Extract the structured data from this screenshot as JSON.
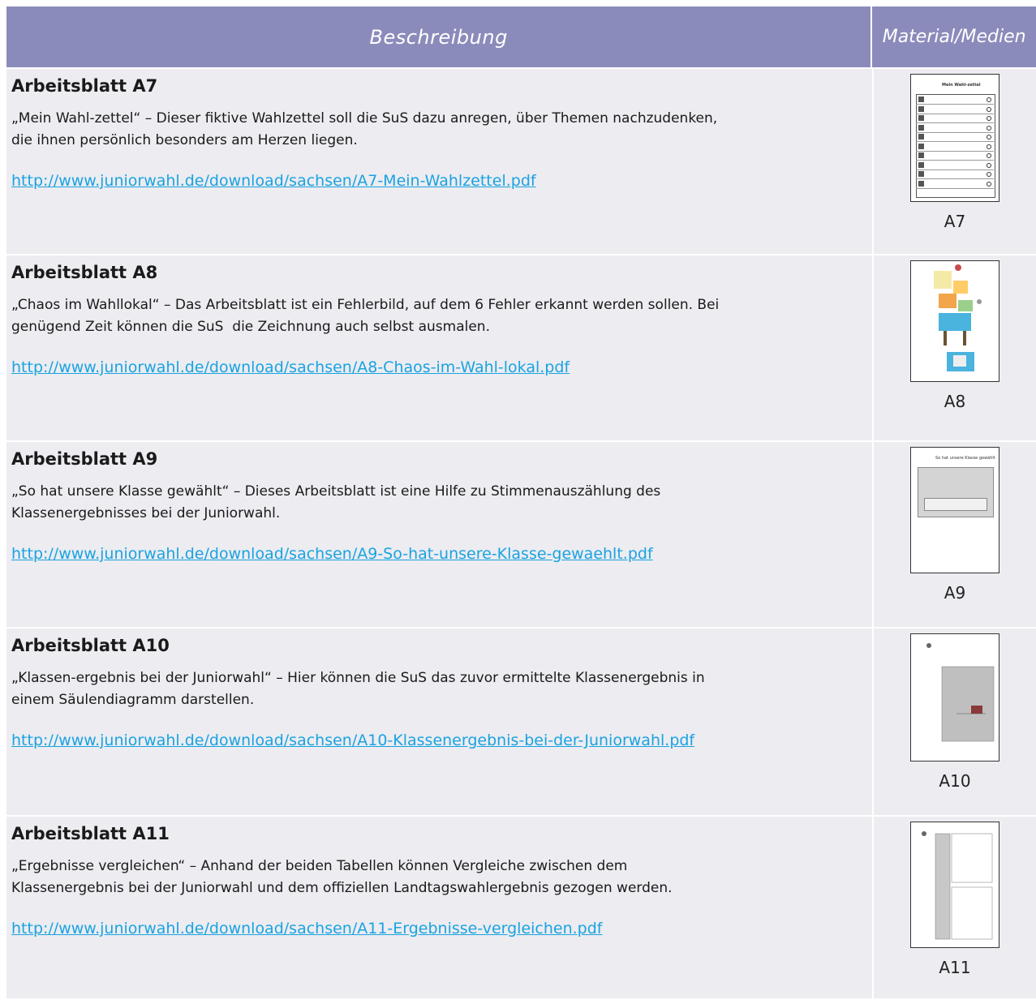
{
  "header": {
    "col1": "Beschreibung",
    "col2_line1": "Material/",
    "col2_line2": "Medien"
  },
  "rows": [
    {
      "title": "Arbeitsblatt A7",
      "desc": "„Mein Wahl-zettel“ – Dieser fiktive Wahlzettel soll die SuS dazu anregen, über Themen nachzudenken,\ndie ihnen persönlich besonders am Herzen liegen.",
      "link": "http://www.juniorwahl.de/download/sachsen/A7-Mein-Wahlzettel.pdf",
      "caption": "A7",
      "thumb_title": "Mein Wahl-zettel"
    },
    {
      "title": "Arbeitsblatt A8",
      "desc": "„Chaos im Wahllokal“ – Das Arbeitsblatt ist ein Fehlerbild, auf dem 6 Fehler erkannt werden sollen. Bei\ngenügend Zeit können die SuS  die Zeichnung auch selbst ausmalen.",
      "link": "http://www.juniorwahl.de/download/sachsen/A8-Chaos-im-Wahl-lokal.pdf",
      "caption": "A8"
    },
    {
      "title": "Arbeitsblatt A9",
      "desc": "„So hat unsere Klasse gewählt“ – Dieses Arbeitsblatt ist eine Hilfe zu Stimmenauszählung des\nKlassenergebnisses bei der Juniorwahl.",
      "link": "http://www.juniorwahl.de/download/sachsen/A9-So-hat-unsere-Klasse-gewaehlt.pdf",
      "caption": "A9",
      "thumb_title": "So hat unsere Klasse gewählt"
    },
    {
      "title": "Arbeitsblatt A10",
      "desc": "„Klassen-ergebnis bei der Juniorwahl“ – Hier können die SuS das zuvor ermittelte Klassenergebnis in\neinem Säulendiagramm darstellen.",
      "link": "http://www.juniorwahl.de/download/sachsen/A10-Klassenergebnis-bei-der-Juniorwahl.pdf",
      "caption": "A10"
    },
    {
      "title": "Arbeitsblatt A11",
      "desc": "„Ergebnisse vergleichen“ – Anhand der beiden Tabellen können Vergleiche zwischen dem\nKlassenergebnis bei der Juniorwahl und dem offiziellen Landtagswahlergebnis gezogen werden.",
      "link": "http://www.juniorwahl.de/download/sachsen/A11-Ergebnisse-vergleichen.pdf",
      "caption": "A11"
    }
  ],
  "colors": {
    "header_bg": "#8b8bbb",
    "row_bg": "#ececf1",
    "link": "#1aa3e0"
  }
}
